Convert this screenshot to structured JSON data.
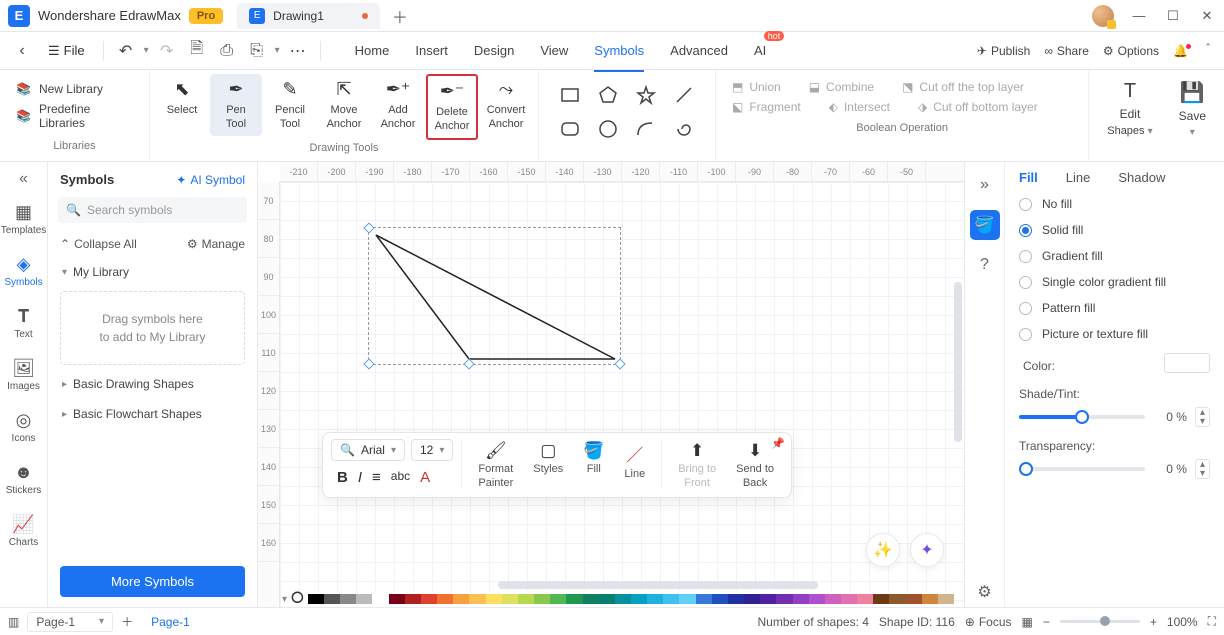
{
  "app": {
    "name": "Wondershare EdrawMax",
    "badge": "Pro"
  },
  "tab": {
    "title": "Drawing1"
  },
  "menubar": {
    "file": "File",
    "tabs": [
      "Home",
      "Insert",
      "Design",
      "View",
      "Symbols",
      "Advanced",
      "AI"
    ],
    "active": "Symbols",
    "right": {
      "publish": "Publish",
      "share": "Share",
      "options": "Options"
    }
  },
  "ribbon": {
    "lib": {
      "new": "New Library",
      "pre": "Predefine Libraries",
      "label": "Libraries"
    },
    "tools": {
      "select": "Select",
      "pen": [
        "Pen",
        "Tool"
      ],
      "pencil": [
        "Pencil",
        "Tool"
      ],
      "move": [
        "Move",
        "Anchor"
      ],
      "add": [
        "Add",
        "Anchor"
      ],
      "delete": [
        "Delete",
        "Anchor"
      ],
      "convert": [
        "Convert",
        "Anchor"
      ],
      "label": "Drawing Tools"
    },
    "bool": {
      "union": "Union",
      "combine": "Combine",
      "cutTop": "Cut off the top layer",
      "fragment": "Fragment",
      "intersect": "Intersect",
      "cutBottom": "Cut off bottom layer",
      "label": "Boolean Operation"
    },
    "right": {
      "edit": "Edit",
      "save": "Save",
      "shapes": "Shapes"
    }
  },
  "leftrail": [
    "Templates",
    "Symbols",
    "Text",
    "Images",
    "Icons",
    "Stickers",
    "Charts"
  ],
  "symbols": {
    "title": "Symbols",
    "ai": "AI Symbol",
    "search_ph": "Search symbols",
    "collapse": "Collapse All",
    "manage": "Manage",
    "mylib": "My Library",
    "drop1": "Drag symbols here",
    "drop2": "to add to My Library",
    "sec1": "Basic Drawing Shapes",
    "sec2": "Basic Flowchart Shapes",
    "more": "More Symbols"
  },
  "ruler_h": [
    "-210",
    "-200",
    "-190",
    "-180",
    "-170",
    "-160",
    "-150",
    "-140",
    "-130",
    "-120",
    "-110",
    "-100",
    "-90",
    "-80",
    "-70",
    "-60",
    "-50"
  ],
  "ruler_v": [
    "70",
    "80",
    "90",
    "100",
    "110",
    "120",
    "130",
    "140",
    "150",
    "160"
  ],
  "float": {
    "font": "Arial",
    "size": "12",
    "format": [
      "Format",
      "Painter"
    ],
    "styles": "Styles",
    "fill": "Fill",
    "line": "Line",
    "bring": [
      "Bring to",
      "Front"
    ],
    "send": [
      "Send to",
      "Back"
    ]
  },
  "rightpanel": {
    "tabs": [
      "Fill",
      "Line",
      "Shadow"
    ],
    "opts": [
      "No fill",
      "Solid fill",
      "Gradient fill",
      "Single color gradient fill",
      "Pattern fill",
      "Picture or texture fill"
    ],
    "selected": "Solid fill",
    "color": "Color:",
    "shade": "Shade/Tint:",
    "trans": "Transparency:",
    "shade_val": "0 %",
    "trans_val": "0 %"
  },
  "status": {
    "page": "Page-1",
    "tab": "Page-1",
    "shapes": "Number of shapes: 4",
    "shapeid": "Shape ID: 116",
    "focus": "Focus",
    "zoom": "100%"
  },
  "palette_colors": [
    "#000",
    "#555",
    "#888",
    "#bbb",
    "#fff",
    "#7a0019",
    "#b02020",
    "#e04030",
    "#f07030",
    "#f8a040",
    "#fbc050",
    "#fde060",
    "#dfe060",
    "#b8d850",
    "#88c850",
    "#50b850",
    "#209850",
    "#108060",
    "#088070",
    "#0890a0",
    "#08a0c0",
    "#20b0e0",
    "#40c0f0",
    "#60d0f8",
    "#3878d8",
    "#2050c0",
    "#2030a0",
    "#302090",
    "#5020a0",
    "#7030b0",
    "#9040c0",
    "#b050d0",
    "#d060c0",
    "#e070b0",
    "#f080a0",
    "#6b3a14",
    "#8b5a2b",
    "#a0522d",
    "#cd853f",
    "#d2b48c"
  ]
}
